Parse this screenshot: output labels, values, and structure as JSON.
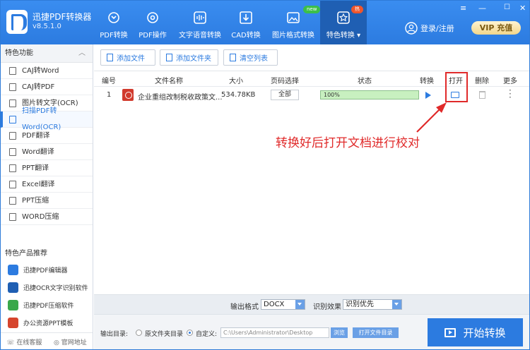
{
  "app": {
    "title": "迅捷PDF转换器",
    "version": "v8.5.1.0"
  },
  "nav": [
    {
      "label": "PDF转换"
    },
    {
      "label": "PDF操作"
    },
    {
      "label": "文字语音转换"
    },
    {
      "label": "CAD转换"
    },
    {
      "label": "图片格式转换",
      "badge": "new"
    },
    {
      "label": "特色转换 ▾",
      "badge": "热"
    }
  ],
  "header": {
    "login": "登录/注册",
    "vip": "VIP 充值"
  },
  "sidebar": {
    "section_title": "特色功能",
    "items": [
      {
        "label": "CAJ转Word"
      },
      {
        "label": "CAJ转PDF"
      },
      {
        "label": "图片转文字(OCR)"
      },
      {
        "label": "扫描PDF转Word(OCR)"
      },
      {
        "label": "PDF翻译"
      },
      {
        "label": "Word翻译"
      },
      {
        "label": "PPT翻译"
      },
      {
        "label": "Excel翻译"
      },
      {
        "label": "PPT压缩"
      },
      {
        "label": "WORD压缩"
      }
    ],
    "recommend_title": "特色产品推荐",
    "recommend": [
      {
        "label": "迅捷PDF编辑器"
      },
      {
        "label": "迅捷OCR文字识别软件"
      },
      {
        "label": "迅捷PDF压缩软件"
      },
      {
        "label": "办公资源PPT模板"
      }
    ],
    "footer": {
      "service": "在线客服",
      "website": "官网地址"
    }
  },
  "toolbar": {
    "add_file": "添加文件",
    "add_folder": "添加文件夹",
    "clear_list": "清空列表"
  },
  "table": {
    "headers": {
      "index": "编号",
      "filename": "文件名称",
      "size": "大小",
      "page": "页码选择",
      "status": "状态",
      "convert": "转换",
      "open": "打开",
      "delete": "删除",
      "more": "更多"
    },
    "rows": [
      {
        "index": "1",
        "filename": "企业重组改制税收政策文...",
        "size": "534.78KB",
        "page": "全部",
        "progress_label": "100%",
        "progress": 100
      }
    ]
  },
  "annotation": "转换好后打开文档进行校对",
  "output": {
    "format_label": "输出格式",
    "format_value": "DOCX",
    "effect_label": "识别效果",
    "effect_value": "识别优先",
    "dir_label": "输出目录:",
    "opt_original": "原文件夹目录",
    "opt_custom": "自定义:",
    "path": "C:\\Users\\Administrator\\Desktop",
    "browse": "浏览",
    "open_folder": "打开文件目录"
  },
  "start_button": "开始转换",
  "colors": {
    "primary": "#2c7be0",
    "highlight": "#e02a2a",
    "progress": "#c8f0c0"
  }
}
